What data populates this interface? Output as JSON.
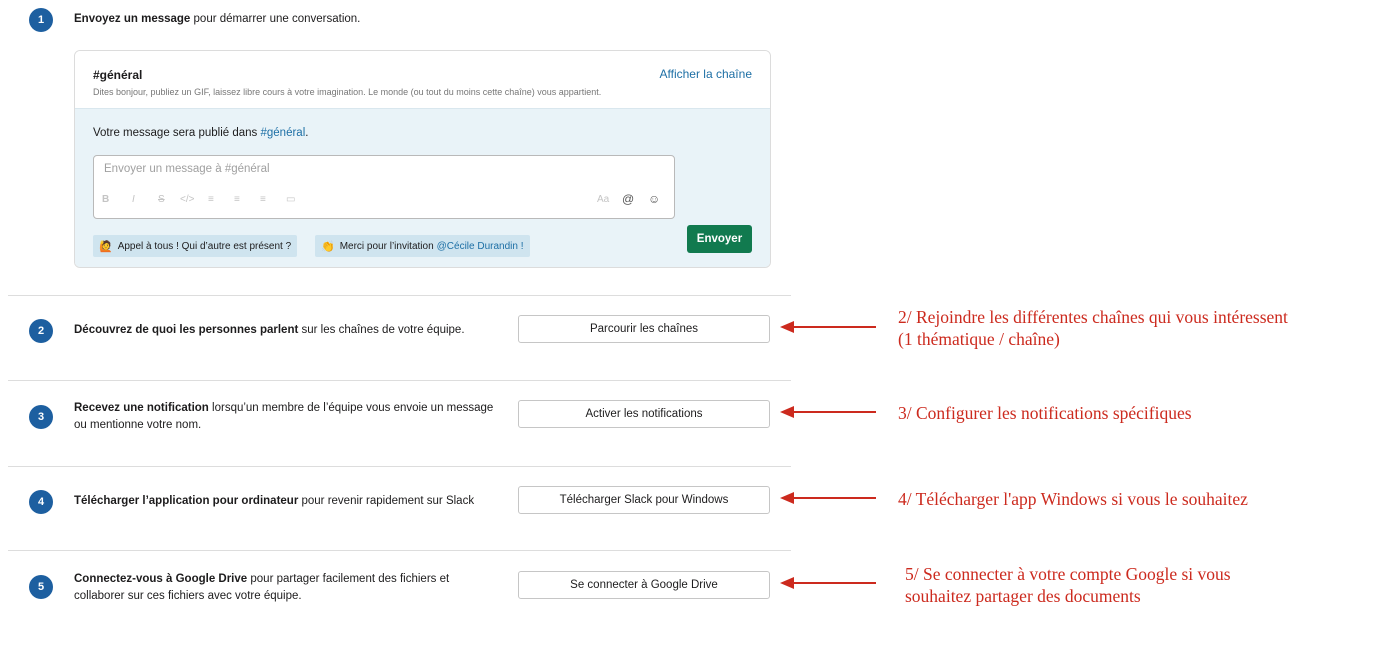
{
  "steps": [
    {
      "number": "1",
      "bold": "Envoyez un message",
      "rest": " pour démarrer une conversation."
    },
    {
      "number": "2",
      "bold": "Découvrez de quoi les personnes parlent",
      "rest": " sur les chaînes de votre équipe.",
      "button": "Parcourir les chaînes",
      "annotation": [
        "2/ Rejoindre les différentes chaînes qui vous intéressent",
        "(1 thématique / chaîne)"
      ]
    },
    {
      "number": "3",
      "bold": "Recevez une notification",
      "rest": " lorsqu’un membre de l’équipe vous envoie un message",
      "rest2": "ou mentionne votre nom.",
      "button": "Activer les notifications",
      "annotation": [
        "3/ Configurer les notifications spécifiques"
      ]
    },
    {
      "number": "4",
      "bold": "Télécharger l’application pour ordinateur",
      "rest": " pour revenir rapidement sur Slack",
      "button": "Télécharger Slack pour Windows",
      "annotation": [
        "4/ Télécharger l'app Windows si vous le souhaitez"
      ]
    },
    {
      "number": "5",
      "bold": "Connectez-vous à Google Drive",
      "rest": " pour partager facilement des fichiers et",
      "rest2": "collaborer sur ces fichiers avec votre équipe.",
      "button": "Se connecter à Google Drive",
      "annotation": [
        "5/ Se connecter à votre compte Google si vous",
        "souhaitez partager des documents"
      ]
    }
  ],
  "card": {
    "channel": "#général",
    "view_link": "Afficher la chaîne",
    "description": "Dites bonjour, publiez un GIF, laissez libre cours à votre imagination. Le monde (ou tout du moins cette chaîne) vous appartient.",
    "publish_prefix": "Votre message sera publié dans ",
    "publish_channel": "#général",
    "publish_suffix": ".",
    "placeholder": "Envoyer un message à #général",
    "format_icons": [
      "B",
      "I",
      "S",
      "</>",
      "≡",
      "≡",
      "≡",
      "▭"
    ],
    "right_icons": [
      "Aa",
      "@",
      "☺"
    ],
    "send_label": "Envoyer",
    "chips": [
      {
        "emoji": "🙋",
        "text": "Appel à tous ! Qui d’autre est présent ?",
        "mention": ""
      },
      {
        "emoji": "👏",
        "text": "Merci pour l’invitation",
        "mention": "@Cécile Durandin !"
      }
    ]
  },
  "colors": {
    "badge": "#1d5fa0",
    "send": "#117a4f",
    "annotation": "#cc2a1e",
    "link": "#1d6fa5"
  }
}
